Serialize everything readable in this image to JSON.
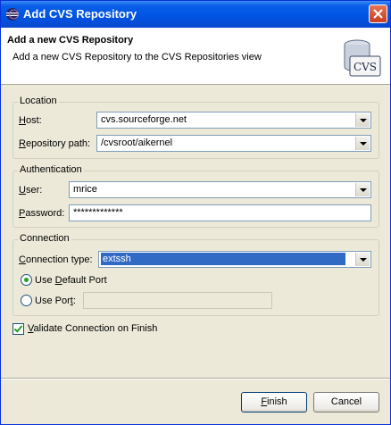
{
  "window": {
    "title": "Add CVS Repository",
    "close_symbol": "×"
  },
  "banner": {
    "title": "Add a new CVS Repository",
    "description": "Add a new CVS Repository to the CVS Repositories view",
    "icon_text": "CVS"
  },
  "location": {
    "legend": "Location",
    "host_label": "Host:",
    "host_value": "cvs.sourceforge.net",
    "path_label": "Repository path:",
    "path_value": "/cvsroot/aikernel"
  },
  "authentication": {
    "legend": "Authentication",
    "user_label": "User:",
    "user_value": "mrice",
    "password_label": "Password:",
    "password_value": "*************"
  },
  "connection": {
    "legend": "Connection",
    "type_label": "Connection type:",
    "type_value": "extssh",
    "default_port_label": "Use Default Port",
    "port_label": "Use Port:",
    "port_value": ""
  },
  "validate": {
    "label": "Validate Connection on Finish",
    "checked": true
  },
  "buttons": {
    "finish": "Finish",
    "cancel": "Cancel"
  },
  "colors": {
    "titlebar": "#0054E3",
    "selection": "#316AC5",
    "accent_check": "#21A121"
  }
}
